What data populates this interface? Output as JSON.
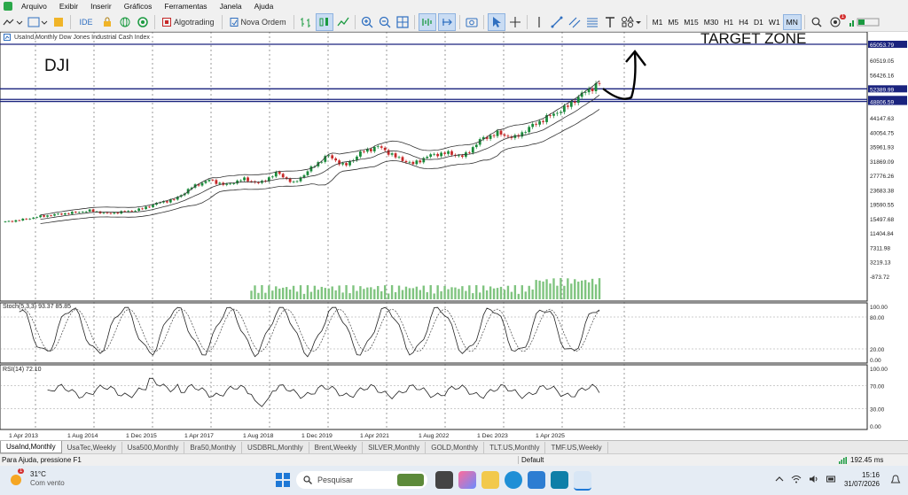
{
  "menu": [
    "Arquivo",
    "Exibir",
    "Inserir",
    "Gráficos",
    "Ferramentas",
    "Janela",
    "Ajuda"
  ],
  "toolbar": {
    "ide": "IDE",
    "algotrading": "Algotrading",
    "nova_ordem": "Nova Ordem",
    "timeframes": [
      "M1",
      "M5",
      "M15",
      "M30",
      "H1",
      "H4",
      "D1",
      "W1",
      "MN"
    ],
    "active_timeframe": "MN",
    "notif_count": "1"
  },
  "chart": {
    "header": "UsaInd,Monthly  Dow Jones Industrial Cash Index",
    "overlay_label": "DJI",
    "target_label": "TARGET ZONE",
    "stoch_label": "Stoch(5,3,3) 93.37 85.85",
    "rsi_label": "RSI(14) 72.10"
  },
  "chart_data": {
    "type": "candlestick",
    "symbol": "UsaInd",
    "timeframe": "Monthly",
    "price_ticks": [
      "65053.79",
      "60519.05",
      "56426.16",
      "52389.99",
      "49383.18",
      "48806.59",
      "44147.63",
      "40054.75",
      "35961.93",
      "31869.09",
      "27776.26",
      "23683.38",
      "19590.55",
      "15497.68",
      "11404.84",
      "7311.98",
      "3219.13",
      "-873.72"
    ],
    "price_ticks_highlighted": [
      "65053.79",
      "52389.99",
      "49383.18",
      "48806.59"
    ],
    "price_ticks_shown": [
      "65053.79",
      "60519.05",
      "56426.16",
      "",
      "",
      "",
      "44147.63",
      "40054.75",
      "35961.93",
      "31869.09",
      "27776.26",
      "23683.38",
      "19590.55",
      "15497.68",
      "11404.84",
      "7311.98",
      "3219.13",
      "-873.72"
    ],
    "price_ticks_overlay": [
      "52389.99",
      "49383.18",
      "48806.59"
    ],
    "horizontal_levels": [
      65053.79,
      52389.99,
      49383.18,
      48806.59
    ],
    "stoch_ticks": [
      "100.00",
      "80.00",
      "20.00",
      "0.00"
    ],
    "rsi_ticks": [
      "100.00",
      "70.00",
      "30.00",
      "0.00"
    ],
    "time_labels": [
      "1 Apr 2013",
      "1 Aug 2014",
      "1 Dec 2015",
      "1 Apr 2017",
      "1 Aug 2018",
      "1 Dec 2019",
      "1 Apr 2021",
      "1 Aug 2022",
      "1 Dec 2023",
      "1 Apr 2025"
    ],
    "close_path": [
      14600,
      15200,
      16100,
      16700,
      17200,
      17800,
      16900,
      17500,
      18200,
      20000,
      21000,
      24500,
      26500,
      25000,
      26800,
      25500,
      28600,
      25500,
      29800,
      33500,
      30400,
      34500,
      36000,
      33000,
      31000,
      33500,
      34200,
      33100,
      38000,
      39800,
      38400,
      41800,
      44500,
      47000,
      51000,
      54000
    ],
    "price_range": [
      -873.72,
      65053.79
    ],
    "bullish_color": "#1a8a3a",
    "bearish_color": "#c62828",
    "level_color": "#1a237e"
  },
  "tabs": [
    "UsaInd,Monthly",
    "UsaTec,Weekly",
    "Usa500,Monthly",
    "Bra50,Monthly",
    "USDBRL,Monthly",
    "Brent,Weekly",
    "SILVER,Monthly",
    "GOLD,Monthly",
    "TLT.US,Monthly",
    "TMF.US,Weekly"
  ],
  "active_tab": "UsaInd,Monthly",
  "status": {
    "help": "Para Ajuda, pressione F1",
    "profile": "Default",
    "ping": "192.45 ms"
  },
  "taskbar": {
    "weather_temp": "31°C",
    "weather_desc": "Com vento",
    "weather_badge": "1",
    "search_placeholder": "Pesquisar",
    "time": "15:16",
    "date": "31/07/2026"
  }
}
